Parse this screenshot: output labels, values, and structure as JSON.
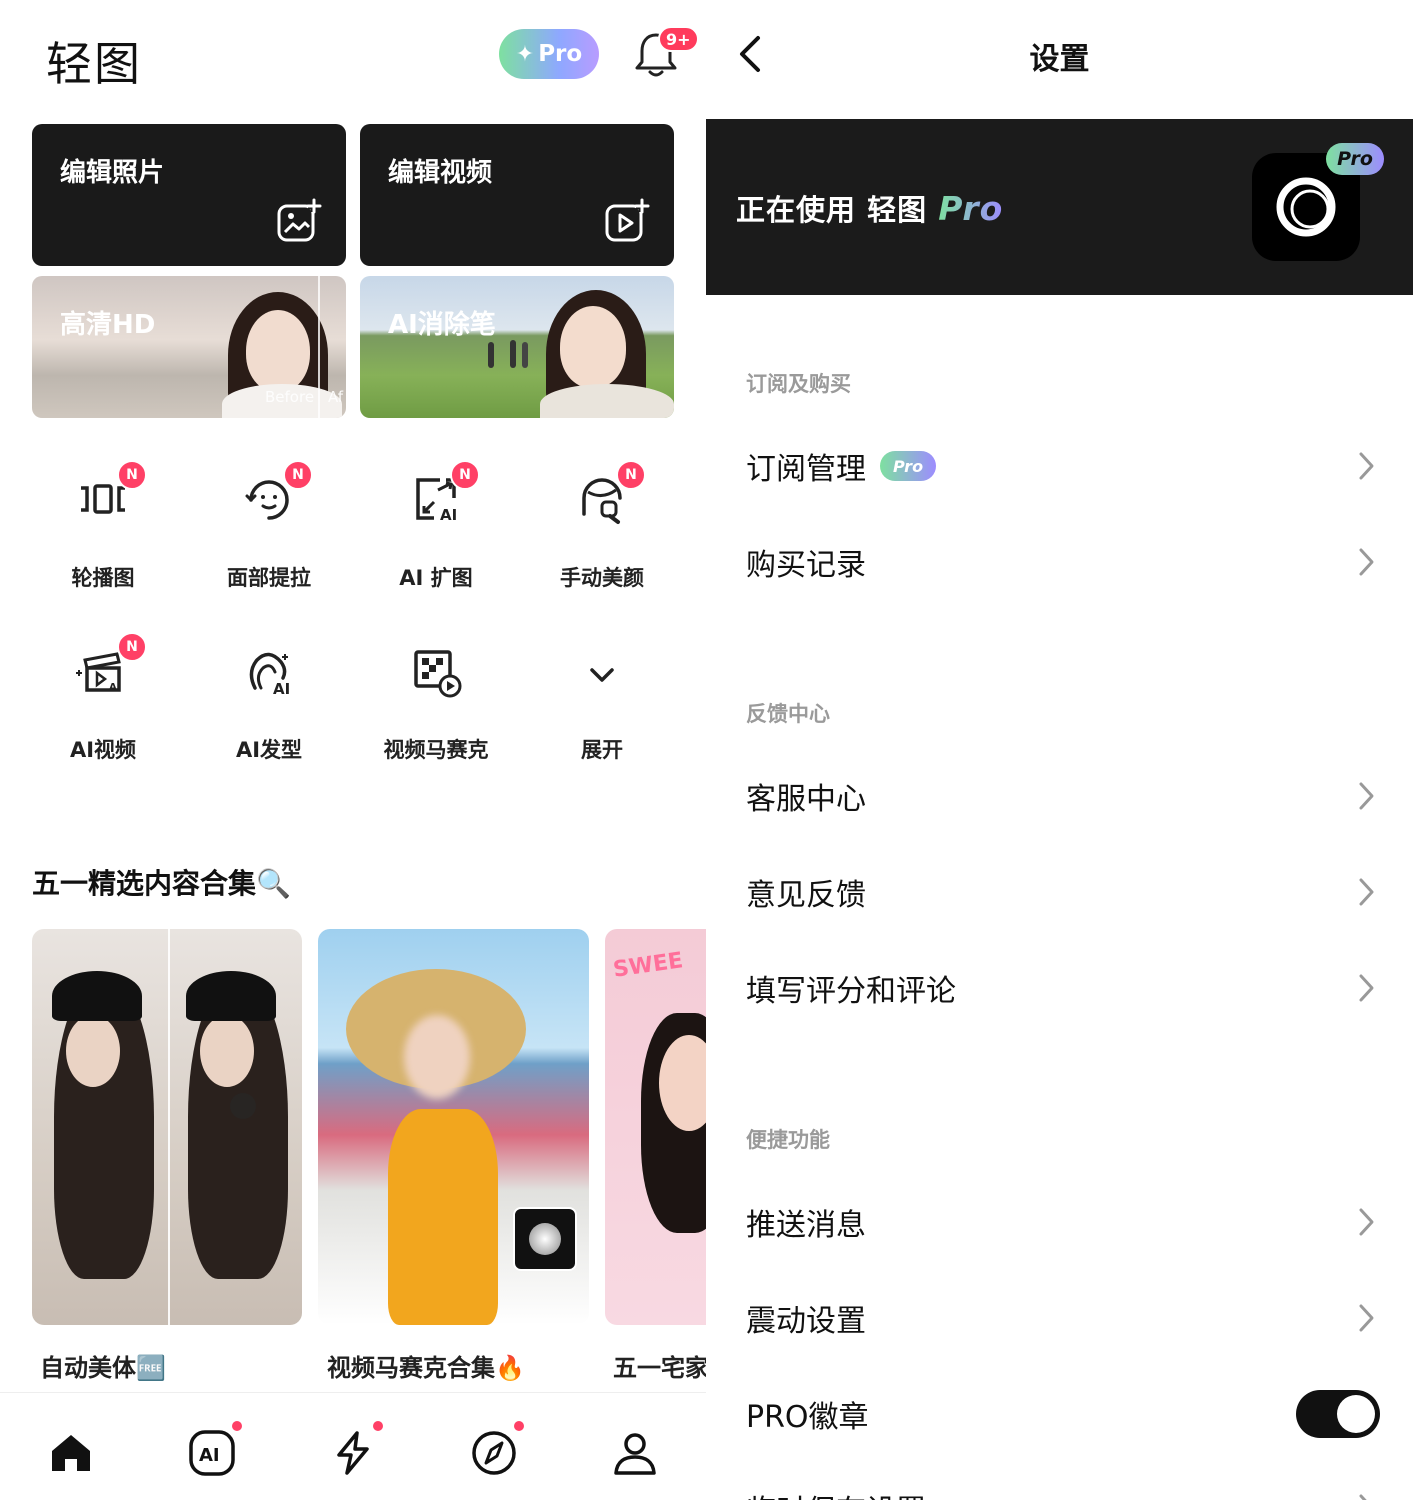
{
  "home": {
    "logo": "轻图",
    "pro_pill": {
      "star": "✦",
      "label": "Pro"
    },
    "notif_badge": "9+",
    "tiles": {
      "edit_photo": "编辑照片",
      "edit_video": "编辑视频",
      "hd": "高清HD",
      "hd_before": "Before",
      "hd_after": "Af",
      "eraser": "AI消除笔"
    },
    "tools": [
      {
        "label": "轮播图",
        "new": "N",
        "icon": "carousel-icon"
      },
      {
        "label": "面部提拉",
        "new": "N",
        "icon": "face-lift-icon"
      },
      {
        "label": "AI 扩图",
        "new": "N",
        "icon": "ai-expand-icon"
      },
      {
        "label": "手动美颜",
        "new": "N",
        "icon": "manual-beauty-icon"
      },
      {
        "label": "AI视频",
        "new": "N",
        "icon": "ai-video-icon"
      },
      {
        "label": "AI发型",
        "icon": "ai-hairstyle-icon"
      },
      {
        "label": "视频马赛克",
        "icon": "video-mosaic-icon"
      },
      {
        "label": "展开",
        "icon": "chevron-down-icon"
      }
    ],
    "section_title": "五一精选内容合集🔍",
    "cards": [
      {
        "caption": "自动美体🆓"
      },
      {
        "caption": "视频马赛克合集🔥"
      },
      {
        "caption": "五一宅家"
      }
    ],
    "tabs": [
      {
        "icon": "home-icon"
      },
      {
        "icon": "ai-icon",
        "label": "AI"
      },
      {
        "icon": "flash-icon"
      },
      {
        "icon": "compass-icon"
      },
      {
        "icon": "profile-icon"
      }
    ]
  },
  "settings": {
    "title": "设置",
    "banner": {
      "prefix": "正在使用 ",
      "app": "轻图 ",
      "pro": "Pro",
      "tag": "Pro"
    },
    "groups": [
      {
        "header": "订阅及购买",
        "rows": [
          {
            "label": "订阅管理",
            "badge": "Pro"
          },
          {
            "label": "购买记录"
          }
        ]
      },
      {
        "header": "反馈中心",
        "rows": [
          {
            "label": "客服中心"
          },
          {
            "label": "意见反馈"
          },
          {
            "label": "填写评分和评论"
          }
        ]
      },
      {
        "header": "便捷功能",
        "rows": [
          {
            "label": "推送消息"
          },
          {
            "label": "震动设置"
          },
          {
            "label": "PRO徽章",
            "toggle": true
          },
          {
            "label": "临时保存设置"
          }
        ]
      }
    ]
  },
  "colors": {
    "accent_green": "#7ee0a0",
    "accent_purple": "#9d8cff",
    "badge_red": "#ff4066",
    "dark_tile": "#1a1a1a"
  }
}
